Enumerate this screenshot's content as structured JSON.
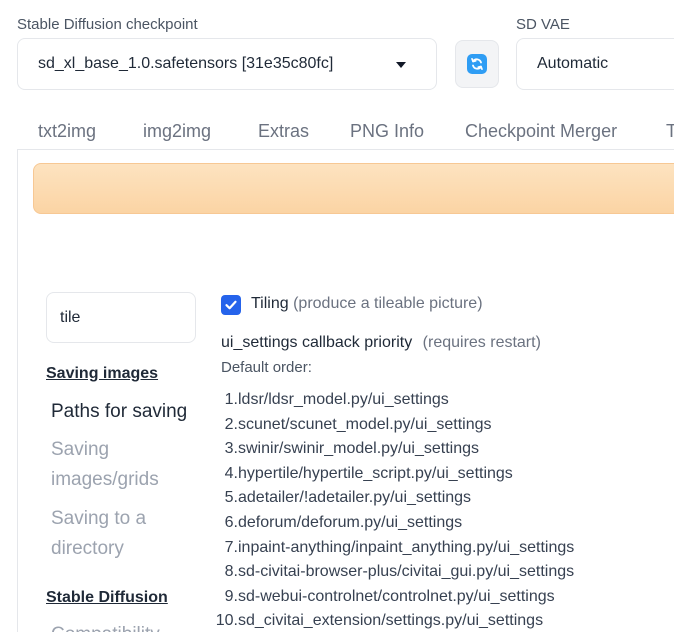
{
  "checkpoint": {
    "label": "Stable Diffusion checkpoint",
    "value": "sd_xl_base_1.0.safetensors [31e35c80fc]"
  },
  "vae": {
    "label": "SD VAE",
    "value": "Automatic"
  },
  "tabs": [
    "txt2img",
    "img2img",
    "Extras",
    "PNG Info",
    "Checkpoint Merger",
    "T"
  ],
  "search": {
    "value": "tile"
  },
  "sidebar": {
    "section_saving": "Saving images",
    "items_saving": [
      "Paths for saving",
      "Saving",
      "images/grids",
      "Saving to a",
      "directory"
    ],
    "section_sd": "Stable Diffusion",
    "item_cut": "Compatibility"
  },
  "settings": {
    "tiling_label": "Tiling",
    "tiling_hint": "(produce a tileable picture)",
    "tiling_checked": true,
    "callback_label": "ui_settings callback priority",
    "callback_hint": "(requires restart)",
    "default_order_label": "Default order:",
    "order": [
      "ldsr/ldsr_model.py/ui_settings",
      "scunet/scunet_model.py/ui_settings",
      "swinir/swinir_model.py/ui_settings",
      "hypertile/hypertile_script.py/ui_settings",
      "adetailer/!adetailer.py/ui_settings",
      "deforum/deforum.py/ui_settings",
      "inpaint-anything/inpaint_anything.py/ui_settings",
      "sd-civitai-browser-plus/civitai_gui.py/ui_settings",
      "sd-webui-controlnet/controlnet.py/ui_settings",
      "sd_civitai_extension/settings.py/ui_settings"
    ]
  },
  "colors": {
    "accent": "#2563eb",
    "refresh": "#2f9df4",
    "banner": "#fbd4a4"
  }
}
